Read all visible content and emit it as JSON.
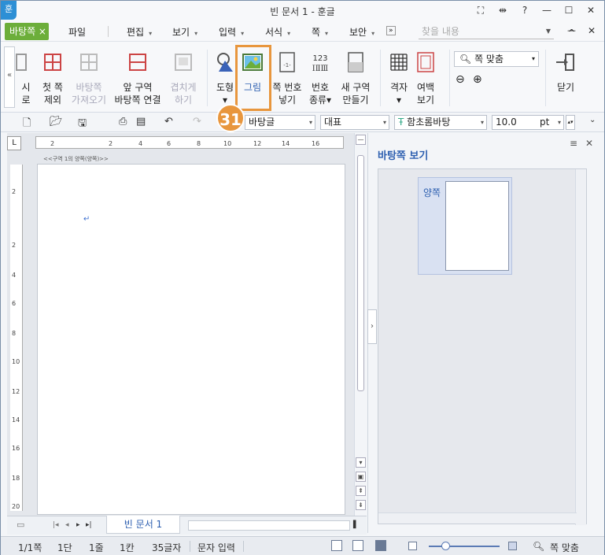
{
  "window": {
    "title": "빈 문서 1 - 훈글",
    "logo": "훈"
  },
  "title_controls": [
    "⛶",
    "⇹",
    "?",
    "—",
    "☐",
    "✕"
  ],
  "menubar": {
    "chip": "바탕쪽 ×",
    "items": [
      {
        "label": "파일",
        "arrow": ""
      },
      {
        "label": "편집",
        "arrow": "▾"
      },
      {
        "label": "보기",
        "arrow": "▾"
      },
      {
        "label": "입력",
        "arrow": "▾"
      },
      {
        "label": "서식",
        "arrow": "▾"
      },
      {
        "label": "쪽",
        "arrow": "▾"
      },
      {
        "label": "보안",
        "arrow": "▾"
      }
    ],
    "more": "»",
    "search_placeholder": "찾을 내용",
    "right_controls": [
      "—",
      "^",
      "✕"
    ]
  },
  "ribbon": {
    "buttons": [
      {
        "label": "시\n로",
        "disabled": false
      },
      {
        "label": "첫 쪽\n제외",
        "disabled": false
      },
      {
        "label": "바탕쪽\n가져오기",
        "disabled": true
      },
      {
        "label": "앞 구역\n바탕쪽 연결",
        "disabled": false
      },
      {
        "label": "겹치게\n하기",
        "disabled": true
      },
      {
        "label": "도형\n▾",
        "disabled": false
      },
      {
        "label": "그림",
        "disabled": false
      },
      {
        "label": "쪽 번호\n넣기",
        "disabled": false
      },
      {
        "label": "번호\n종류▾",
        "disabled": false
      },
      {
        "label": "새 구역\n만들기",
        "disabled": false
      },
      {
        "label": "격자\n▾",
        "disabled": false
      },
      {
        "label": "여백\n보기",
        "disabled": false
      },
      {
        "label": "닫기",
        "disabled": false
      }
    ],
    "zoom_value": "쪽 맞춤",
    "callout_number": "31"
  },
  "format_bar": {
    "style": "바탕글",
    "language": "대표",
    "font": "함초롬바탕",
    "size": "10.0",
    "unit": "pt"
  },
  "document": {
    "section_label": "<<구역 1의 양쪽(양쪽)>>",
    "hruler_ticks": [
      "2",
      "2",
      "4",
      "6",
      "8",
      "10",
      "12",
      "14",
      "16"
    ],
    "vruler_ticks": [
      "2",
      "2",
      "4",
      "6",
      "8",
      "10",
      "12",
      "14",
      "16",
      "18",
      "20"
    ],
    "paragraph_mark": "↵",
    "tab_name": "빈 문서 1"
  },
  "pane": {
    "title": "바탕쪽 보기",
    "thumb_label": "양쪽"
  },
  "status": {
    "page": "1/1쪽",
    "column": "1단",
    "line": "1줄",
    "cell": "1칸",
    "chars": "35글자",
    "mode": "문자 입력",
    "zoom": "쪽 맞춤"
  }
}
